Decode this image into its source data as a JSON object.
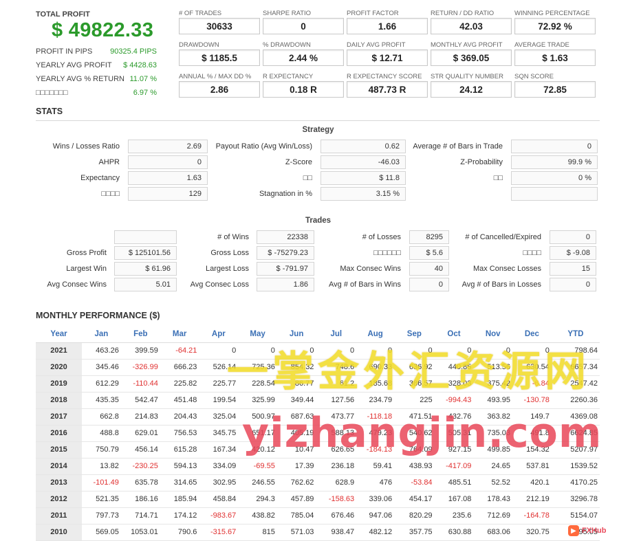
{
  "summary": {
    "total_profit_label": "TOTAL PROFIT",
    "total_profit_value": "$ 49822.33",
    "rows": [
      {
        "label": "PROFIT IN PIPS",
        "value": "90325.4 PIPS"
      },
      {
        "label": "YEARLY AVG PROFIT",
        "value": "$ 4428.63"
      },
      {
        "label": "YEARLY AVG % RETURN",
        "value": "11.07 %"
      },
      {
        "label": "□□□□□□□",
        "value": "6.97 %"
      }
    ]
  },
  "metrics": [
    {
      "label": "# OF TRADES",
      "value": "30633"
    },
    {
      "label": "SHARPE RATIO",
      "value": "0"
    },
    {
      "label": "PROFIT FACTOR",
      "value": "1.66"
    },
    {
      "label": "RETURN / DD RATIO",
      "value": "42.03"
    },
    {
      "label": "WINNING PERCENTAGE",
      "value": "72.92 %"
    },
    {
      "label": "DRAWDOWN",
      "value": "$ 1185.5"
    },
    {
      "label": "% DRAWDOWN",
      "value": "2.44 %"
    },
    {
      "label": "DAILY AVG PROFIT",
      "value": "$ 12.71"
    },
    {
      "label": "MONTHLY AVG PROFIT",
      "value": "$ 369.05"
    },
    {
      "label": "AVERAGE TRADE",
      "value": "$ 1.63"
    },
    {
      "label": "ANNUAL % / MAX DD %",
      "value": "2.86"
    },
    {
      "label": "R EXPECTANCY",
      "value": "0.18 R"
    },
    {
      "label": "R EXPECTANCY SCORE",
      "value": "487.73 R"
    },
    {
      "label": "STR QUALITY NUMBER",
      "value": "24.12"
    },
    {
      "label": "SQN SCORE",
      "value": "72.85"
    }
  ],
  "stats": {
    "title": "STATS",
    "strategy_title": "Strategy",
    "strategy": [
      {
        "label": "Wins / Losses Ratio",
        "value": "2.69"
      },
      {
        "label": "Payout Ratio (Avg Win/Loss)",
        "value": "0.62"
      },
      {
        "label": "Average # of Bars in Trade",
        "value": "0"
      },
      {
        "label": "AHPR",
        "value": "0"
      },
      {
        "label": "Z-Score",
        "value": "-46.03"
      },
      {
        "label": "Z-Probability",
        "value": "99.9 %"
      },
      {
        "label": "Expectancy",
        "value": "1.63"
      },
      {
        "label": "□□",
        "value": "$ 11.8"
      },
      {
        "label": "□□",
        "value": "0 %"
      },
      {
        "label": "□□□□",
        "value": "129"
      },
      {
        "label": "Stagnation in %",
        "value": "3.15 %"
      },
      {
        "label": "",
        "value": ""
      }
    ],
    "trades_title": "Trades",
    "trades": [
      {
        "label": "",
        "value": ""
      },
      {
        "label": "# of Wins",
        "value": "22338"
      },
      {
        "label": "# of Losses",
        "value": "8295"
      },
      {
        "label": "# of Cancelled/Expired",
        "value": "0"
      },
      {
        "label": "Gross Profit",
        "value": "$ 125101.56"
      },
      {
        "label": "Gross Loss",
        "value": "$ -75279.23"
      },
      {
        "label": "□□□□□□",
        "value": "$ 5.6"
      },
      {
        "label": "□□□□",
        "value": "$ -9.08"
      },
      {
        "label": "Largest Win",
        "value": "$ 61.96"
      },
      {
        "label": "Largest Loss",
        "value": "$ -791.97"
      },
      {
        "label": "Max Consec Wins",
        "value": "40"
      },
      {
        "label": "Max Consec Losses",
        "value": "15"
      },
      {
        "label": "Avg Consec Wins",
        "value": "5.01"
      },
      {
        "label": "Avg Consec Loss",
        "value": "1.86"
      },
      {
        "label": "Avg # of Bars in Wins",
        "value": "0"
      },
      {
        "label": "Avg # of Bars in Losses",
        "value": "0"
      }
    ]
  },
  "monthly": {
    "title": "MONTHLY PERFORMANCE ($)",
    "headers": [
      "Year",
      "Jan",
      "Feb",
      "Mar",
      "Apr",
      "May",
      "Jun",
      "Jul",
      "Aug",
      "Sep",
      "Oct",
      "Nov",
      "Dec",
      "YTD"
    ],
    "rows": [
      [
        "2021",
        "463.26",
        "399.59",
        "-64.21",
        "0",
        "0",
        "0",
        "0",
        "0",
        "0",
        "0",
        "0",
        "0",
        "798.64"
      ],
      [
        "2020",
        "345.46",
        "-326.99",
        "666.23",
        "526.14",
        "725.36",
        "854.32",
        "748.6",
        "690.33",
        "636.92",
        "440.85",
        "513.56",
        "630.54",
        "6657.34"
      ],
      [
        "2019",
        "612.29",
        "-110.44",
        "225.82",
        "225.77",
        "228.54",
        "86.77",
        "61.2",
        "185.68",
        "386.57",
        "328.03",
        "375.42",
        "-6.84",
        "2547.42"
      ],
      [
        "2018",
        "435.35",
        "542.47",
        "451.48",
        "199.54",
        "325.99",
        "349.44",
        "127.56",
        "234.79",
        "225",
        "-994.43",
        "493.95",
        "-130.78",
        "2260.36"
      ],
      [
        "2017",
        "662.8",
        "214.83",
        "204.43",
        "325.04",
        "500.97",
        "687.63",
        "473.77",
        "-118.18",
        "471.51",
        "432.76",
        "363.82",
        "149.7",
        "4369.08"
      ],
      [
        "2016",
        "488.8",
        "629.01",
        "756.53",
        "345.75",
        "651.17",
        "405.19",
        "588.13",
        "479.23",
        "540.62",
        "505.31",
        "735.03",
        "491.8",
        "6624.85"
      ],
      [
        "2015",
        "750.79",
        "456.14",
        "615.28",
        "167.34",
        "420.12",
        "10.47",
        "626.65",
        "-184.13",
        "764.09",
        "927.15",
        "499.85",
        "154.32",
        "5207.97"
      ],
      [
        "2014",
        "13.82",
        "-230.25",
        "594.13",
        "334.09",
        "-69.55",
        "17.39",
        "236.18",
        "59.41",
        "438.93",
        "-417.09",
        "24.65",
        "537.81",
        "1539.52"
      ],
      [
        "2013",
        "-101.49",
        "635.78",
        "314.65",
        "302.95",
        "246.55",
        "762.62",
        "628.9",
        "476",
        "-53.84",
        "485.51",
        "52.52",
        "420.1",
        "4170.25"
      ],
      [
        "2012",
        "521.35",
        "186.16",
        "185.94",
        "458.84",
        "294.3",
        "457.89",
        "-158.63",
        "339.06",
        "454.17",
        "167.08",
        "178.43",
        "212.19",
        "3296.78"
      ],
      [
        "2011",
        "797.73",
        "714.71",
        "174.12",
        "-983.67",
        "438.82",
        "785.04",
        "676.46",
        "947.06",
        "820.29",
        "235.6",
        "712.69",
        "-164.78",
        "5154.07"
      ],
      [
        "2010",
        "569.05",
        "1053.01",
        "790.6",
        "-315.67",
        "815",
        "571.03",
        "938.47",
        "482.12",
        "357.75",
        "630.88",
        "683.06",
        "320.75",
        "6895.05"
      ]
    ]
  },
  "watermark": {
    "line1": "一掌金外汇资源网",
    "line2": "yizhangjin.com",
    "badge": "FXHub"
  },
  "colors": {
    "positive": "#2b9a2b",
    "negative": "#e03030",
    "header_blue": "#3a6fb5"
  }
}
